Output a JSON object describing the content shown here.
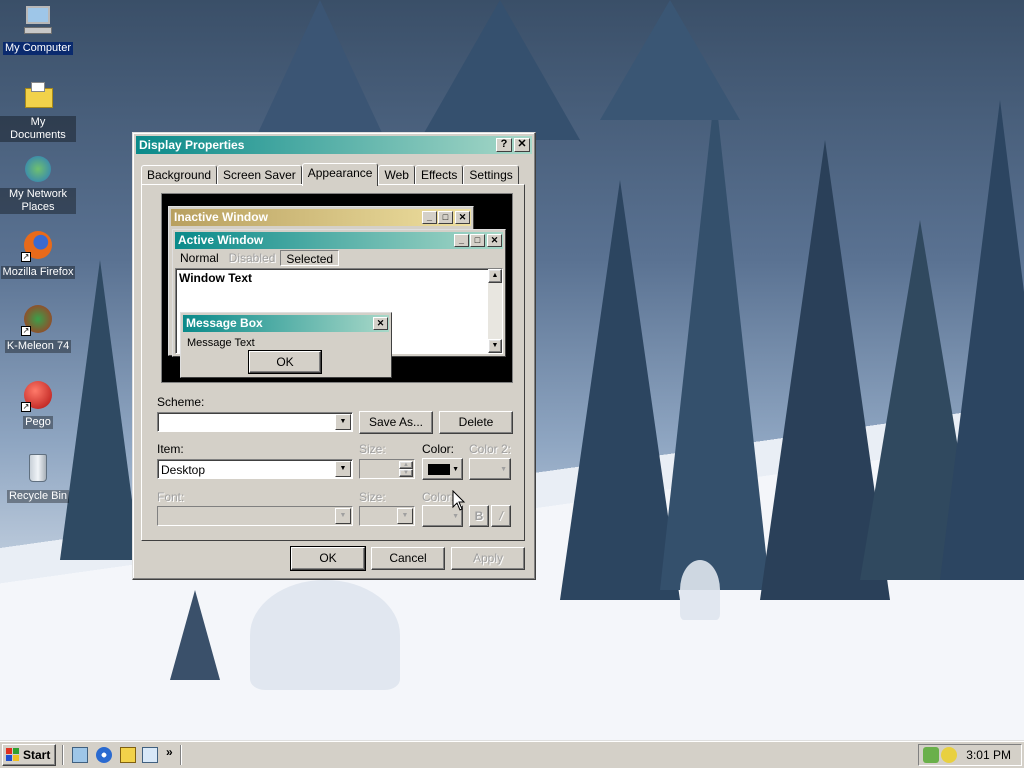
{
  "desktop": {
    "icons": [
      {
        "label": "My Computer"
      },
      {
        "label": "My Documents"
      },
      {
        "label": "My Network Places"
      },
      {
        "label": "Mozilla Firefox"
      },
      {
        "label": "K-Meleon 74"
      },
      {
        "label": "Pego"
      },
      {
        "label": "Recycle Bin"
      }
    ]
  },
  "dialog": {
    "title": "Display Properties",
    "help_btn": "?",
    "close_btn": "✕",
    "tabs": [
      "Background",
      "Screen Saver",
      "Appearance",
      "Web",
      "Effects",
      "Settings"
    ],
    "active_tab": "Appearance",
    "preview": {
      "inactive_title": "Inactive Window",
      "active_title": "Active Window",
      "menu": [
        "Normal",
        "Disabled",
        "Selected"
      ],
      "window_text": "Window Text",
      "msgbox_title": "Message Box",
      "msgbox_text": "Message Text",
      "msgbox_ok": "OK"
    },
    "scheme_label": "Scheme:",
    "scheme_value": "",
    "save_as": "Save As...",
    "delete": "Delete",
    "item_label": "Item:",
    "item_value": "Desktop",
    "size_label": "Size:",
    "color_label": "Color:",
    "color2_label": "Color 2:",
    "font_label": "Font:",
    "font_size_label": "Size:",
    "font_color_label": "Color:",
    "bold": "B",
    "italic": "/",
    "ok": "OK",
    "cancel": "Cancel",
    "apply": "Apply",
    "colors": {
      "title_active": "#0a8a8a",
      "title_inactive": "#b8a060"
    }
  },
  "taskbar": {
    "start": "Start",
    "chevron": "»",
    "clock": "3:01 PM"
  }
}
